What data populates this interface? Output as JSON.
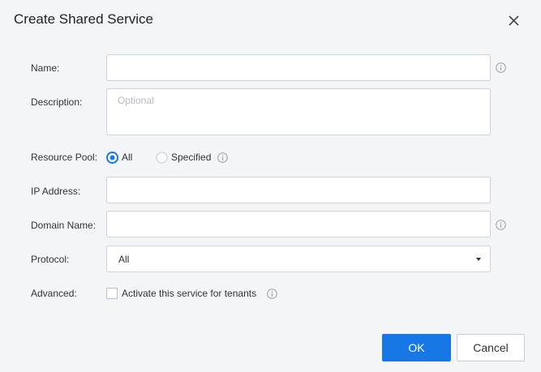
{
  "dialog": {
    "title": "Create Shared Service",
    "close_icon": "close-icon"
  },
  "form": {
    "name": {
      "label": "Name:",
      "value": "",
      "placeholder": ""
    },
    "description": {
      "label": "Description:",
      "value": "",
      "placeholder": "Optional"
    },
    "resource_pool": {
      "label": "Resource Pool:",
      "options": [
        {
          "label": "All",
          "selected": true
        },
        {
          "label": "Specified",
          "selected": false
        }
      ]
    },
    "ip_address": {
      "label": "IP Address:",
      "value": "",
      "placeholder": ""
    },
    "domain_name": {
      "label": "Domain Name:",
      "value": "",
      "placeholder": ""
    },
    "protocol": {
      "label": "Protocol:",
      "value": "All"
    },
    "advanced": {
      "label": "Advanced:",
      "checkbox_label": "Activate this service for tenants",
      "checked": false
    }
  },
  "footer": {
    "ok_label": "OK",
    "cancel_label": "Cancel"
  },
  "colors": {
    "accent": "#1677e5",
    "background": "#f4f5f7",
    "border": "#cfd4dc"
  }
}
